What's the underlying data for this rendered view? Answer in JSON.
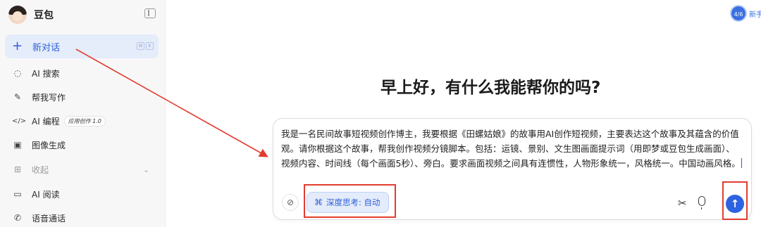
{
  "app": {
    "name": "豆包"
  },
  "sidebar": {
    "new_chat": {
      "label": "新对话",
      "shortcut": [
        "⌘",
        "K"
      ]
    },
    "items": [
      {
        "label": "AI 搜索",
        "icon": "search-icon",
        "glyph": "◌"
      },
      {
        "label": "帮我写作",
        "icon": "pen-icon",
        "glyph": "✎"
      },
      {
        "label": "AI 编程",
        "icon": "code-icon",
        "glyph": "</>",
        "badge": "应用创作 1.0"
      },
      {
        "label": "图像生成",
        "icon": "image-icon",
        "glyph": "▣"
      },
      {
        "label": "收起",
        "icon": "grid-icon",
        "glyph": "⊞"
      },
      {
        "label": "AI 阅读",
        "icon": "book-icon",
        "glyph": "▭"
      },
      {
        "label": "语音通话",
        "icon": "phone-icon",
        "glyph": "✆"
      }
    ]
  },
  "top_right": {
    "badge": "4/6",
    "text": "新手"
  },
  "main": {
    "greeting": "早上好，有什么我能帮你的吗?",
    "prompt": "我是一名民间故事短视频创作博主，我要根据《田螺姑娘》的故事用AI创作短视频，主要表达这个故事及其蕴含的价值观。请你根据这个故事，帮我创作视频分镜脚本。包括：运镜、景别、文生图画面提示词（用即梦或豆包生成画面）、视频内容、时间线（每个画面5秒）、旁白。要求画面视频之间具有连惯性，人物形象统一，风格统一。中国动画风格。",
    "deep_think_label": "深度思考: 自动",
    "send_glyph": "↑"
  },
  "colors": {
    "accent": "#2d5fd7",
    "annotation": "#e23d2f"
  }
}
